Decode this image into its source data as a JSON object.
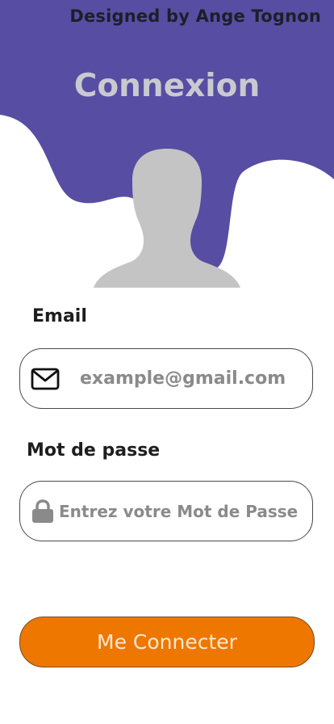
{
  "header": {
    "designer_credit": "Designed by Ange Tognon",
    "title": "Connexion"
  },
  "form": {
    "email": {
      "label": "Email",
      "placeholder": "example@gmail.com",
      "value": "",
      "icon": "mail-icon"
    },
    "password": {
      "label": "Mot de passe",
      "placeholder": "Entrez votre Mot de Passe",
      "value": "",
      "icon": "lock-icon"
    },
    "submit_label": "Me Connecter"
  },
  "colors": {
    "header_purple": "#574da3",
    "button_orange": "#ee7700",
    "avatar_gray": "#c4c4c4"
  }
}
